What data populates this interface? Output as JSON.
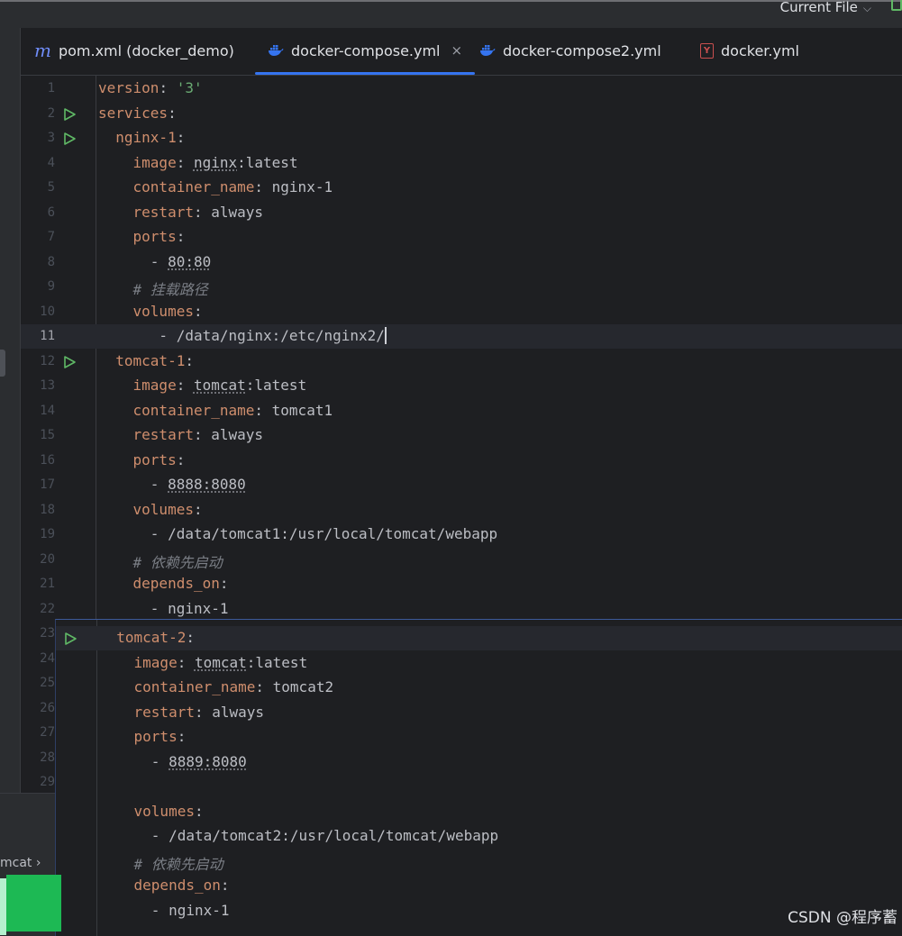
{
  "toolbar": {
    "run_config_label": "Current File"
  },
  "tabs": [
    {
      "label": "pom.xml (docker_demo)",
      "icon": "maven-icon",
      "active": false
    },
    {
      "label": "docker-compose.yml",
      "icon": "docker-icon",
      "active": true,
      "close": "×"
    },
    {
      "label": "docker-compose2.yml",
      "icon": "docker-icon",
      "active": false
    },
    {
      "label": "docker.yml",
      "icon": "yaml-icon",
      "active": false
    }
  ],
  "colors": {
    "background": "#1e1f22",
    "key": "#cf8e6d",
    "string": "#6aab73",
    "text": "#bcbec4",
    "comment": "#7a7e85",
    "accent": "#3574f0",
    "run": "#5fb865"
  },
  "editor": {
    "current_line": 11,
    "lines": [
      {
        "n": "1",
        "text": "version: '3'"
      },
      {
        "n": "2",
        "text": "services:"
      },
      {
        "n": "3",
        "text": "  nginx-1:"
      },
      {
        "n": "4",
        "text": "    image: nginx:latest"
      },
      {
        "n": "5",
        "text": "    container_name: nginx-1"
      },
      {
        "n": "6",
        "text": "    restart: always"
      },
      {
        "n": "7",
        "text": "    ports:"
      },
      {
        "n": "8",
        "text": "      - 80:80"
      },
      {
        "n": "9",
        "text": "    # 挂载路径"
      },
      {
        "n": "10",
        "text": "    volumes:"
      },
      {
        "n": "11",
        "text": "       - /data/nginx:/etc/nginx2/"
      },
      {
        "n": "12",
        "text": "  tomcat-1:"
      },
      {
        "n": "13",
        "text": "    image: tomcat:latest"
      },
      {
        "n": "14",
        "text": "    container_name: tomcat1"
      },
      {
        "n": "15",
        "text": "    restart: always"
      },
      {
        "n": "16",
        "text": "    ports:"
      },
      {
        "n": "17",
        "text": "      - 8888:8080"
      },
      {
        "n": "18",
        "text": "    volumes:"
      },
      {
        "n": "19",
        "text": "      - /data/tomcat1:/usr/local/tomcat/webapp"
      },
      {
        "n": "20",
        "text": "    # 依赖先启动"
      },
      {
        "n": "21",
        "text": "    depends_on:"
      },
      {
        "n": "22",
        "text": "      - nginx-1"
      },
      {
        "n": "23",
        "text": ""
      },
      {
        "n": "24",
        "text": ""
      },
      {
        "n": "25",
        "text": ""
      },
      {
        "n": "26",
        "text": ""
      },
      {
        "n": "27",
        "text": ""
      },
      {
        "n": "28",
        "text": ""
      },
      {
        "n": "29",
        "text": ""
      }
    ]
  },
  "overlay_lines": [
    {
      "text": "  tomcat-2:"
    },
    {
      "text": "    image: tomcat:latest"
    },
    {
      "text": "    container_name: tomcat2"
    },
    {
      "text": "    restart: always"
    },
    {
      "text": "    ports:"
    },
    {
      "text": "      - 8889:8080"
    },
    {
      "text": ""
    },
    {
      "text": "    volumes:"
    },
    {
      "text": "      - /data/tomcat2:/usr/local/tomcat/webapp"
    },
    {
      "text": "    # 依赖先启动"
    },
    {
      "text": "    depends_on:"
    },
    {
      "text": "      - nginx-1"
    }
  ],
  "bottom_panel": {
    "breadcrumb": "mcat",
    "chevron": "›"
  },
  "watermark": "CSDN @程序蓄"
}
